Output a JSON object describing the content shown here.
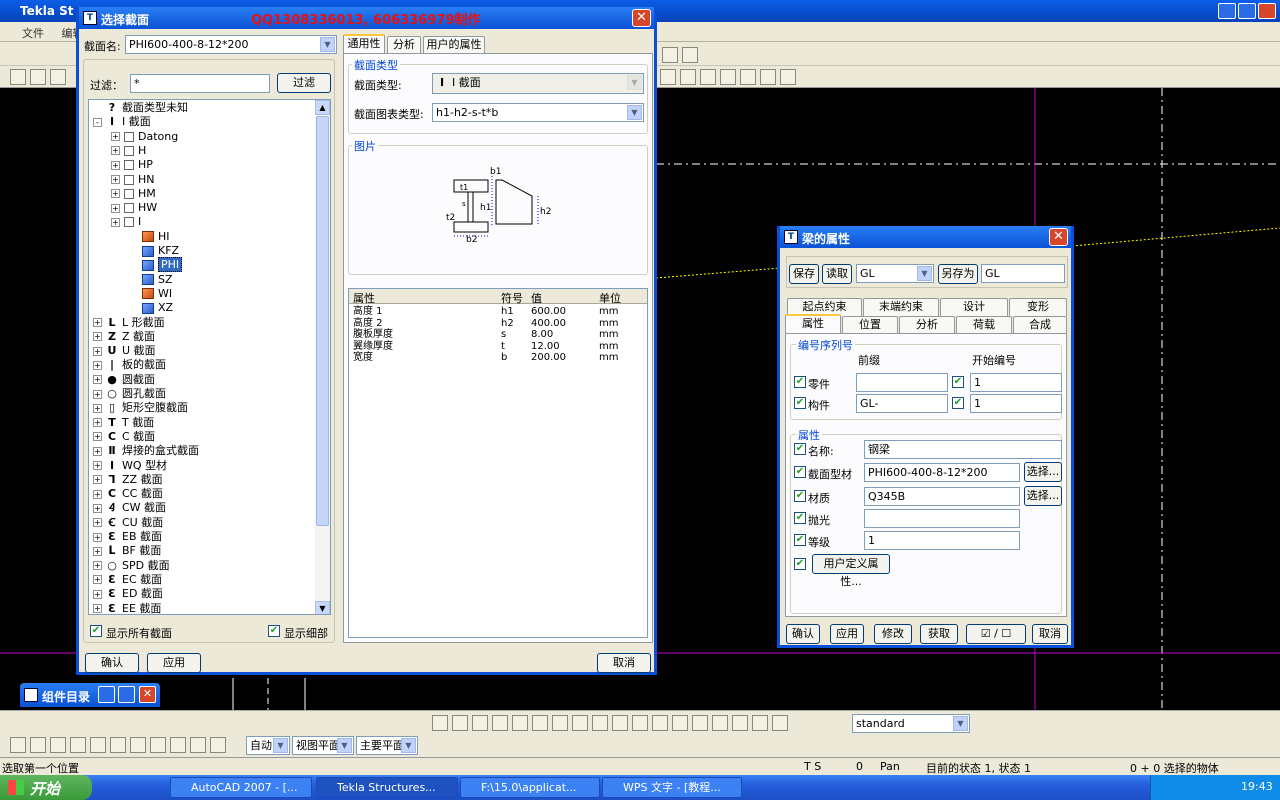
{
  "app": {
    "title": "Tekla St",
    "menu": [
      "文件",
      "编辑"
    ]
  },
  "section_dialog": {
    "title": "选择截面",
    "watermark": "QQ1308336013,  606336979制作",
    "section_name_label": "截面名:",
    "section_name_value": "PHI600-400-8-12*200",
    "filter_label": "过滤：",
    "filter_value": "*",
    "filter_button": "过滤",
    "tree": [
      {
        "label": "截面类型未知",
        "icon": "question-mark-icon",
        "level": 0,
        "exp": ""
      },
      {
        "label": "I 截面",
        "icon": "i-beam-icon",
        "level": 0,
        "exp": "-"
      },
      {
        "label": "Datong",
        "icon": "folder-icon",
        "level": 1,
        "exp": "+"
      },
      {
        "label": "H",
        "icon": "folder-icon",
        "level": 1,
        "exp": "+"
      },
      {
        "label": "HP",
        "icon": "folder-icon",
        "level": 1,
        "exp": "+"
      },
      {
        "label": "HN",
        "icon": "folder-icon",
        "level": 1,
        "exp": "+"
      },
      {
        "label": "HM",
        "icon": "folder-icon",
        "level": 1,
        "exp": "+"
      },
      {
        "label": "HW",
        "icon": "folder-icon",
        "level": 1,
        "exp": "+"
      },
      {
        "label": "I",
        "icon": "folder-icon",
        "level": 1,
        "exp": "+"
      },
      {
        "label": "HI",
        "icon": "cube-orange-icon",
        "level": 2,
        "exp": ""
      },
      {
        "label": "KFZ",
        "icon": "cube-blue-icon",
        "level": 2,
        "exp": ""
      },
      {
        "label": "PHI",
        "icon": "cube-blue-icon",
        "level": 2,
        "exp": "",
        "selected": true
      },
      {
        "label": "SZ",
        "icon": "cube-blue-icon",
        "level": 2,
        "exp": ""
      },
      {
        "label": "WI",
        "icon": "cube-orange-icon",
        "level": 2,
        "exp": ""
      },
      {
        "label": "XZ",
        "icon": "cube-blue-icon",
        "level": 2,
        "exp": ""
      },
      {
        "label": "L 形截面",
        "icon": "L",
        "level": 0,
        "exp": "+"
      },
      {
        "label": "Z 截面",
        "icon": "Z",
        "level": 0,
        "exp": "+"
      },
      {
        "label": "U 截面",
        "icon": "U",
        "level": 0,
        "exp": "+"
      },
      {
        "label": "板的截面",
        "icon": "|",
        "level": 0,
        "exp": "+"
      },
      {
        "label": "圆截面",
        "icon": "●",
        "level": 0,
        "exp": "+"
      },
      {
        "label": "圆孔截面",
        "icon": "○",
        "level": 0,
        "exp": "+"
      },
      {
        "label": "矩形空腹截面",
        "icon": "▯",
        "level": 0,
        "exp": "+"
      },
      {
        "label": "T 截面",
        "icon": "T",
        "level": 0,
        "exp": "+"
      },
      {
        "label": "C 截面",
        "icon": "C",
        "level": 0,
        "exp": "+"
      },
      {
        "label": "焊接的盒式截面",
        "icon": "Ⅱ",
        "level": 0,
        "exp": "+"
      },
      {
        "label": "WQ 型材",
        "icon": "Ⅰ",
        "level": 0,
        "exp": "+"
      },
      {
        "label": "ZZ 截面",
        "icon": "Ꞁ",
        "level": 0,
        "exp": "+"
      },
      {
        "label": "CC 截面",
        "icon": "C",
        "level": 0,
        "exp": "+"
      },
      {
        "label": "CW 截面",
        "icon": "Ꜭ",
        "level": 0,
        "exp": "+"
      },
      {
        "label": "CU 截面",
        "icon": "Ꞓ",
        "level": 0,
        "exp": "+"
      },
      {
        "label": "EB 截面",
        "icon": "Ɛ",
        "level": 0,
        "exp": "+"
      },
      {
        "label": "BF 截面",
        "icon": "ᒪ",
        "level": 0,
        "exp": "+"
      },
      {
        "label": "SPD 截面",
        "icon": "○",
        "level": 0,
        "exp": "+"
      },
      {
        "label": "EC 截面",
        "icon": "Ɛ",
        "level": 0,
        "exp": "+"
      },
      {
        "label": "ED 截面",
        "icon": "Ɛ",
        "level": 0,
        "exp": "+"
      },
      {
        "label": "EE 截面",
        "icon": "Ɛ",
        "level": 0,
        "exp": "+"
      }
    ],
    "show_all_label": "显示所有截面",
    "show_detail_label": "显示细部",
    "tabs": [
      "通用性",
      "分析",
      "用户的属性"
    ],
    "type_group_label": "截面类型",
    "type_label": "截面类型:",
    "type_value": "I 截面",
    "chart_type_label": "截面图表类型:",
    "chart_type_value": "h1-h2-s-t*b",
    "picture_label": "图片",
    "prop_headers": [
      "属性",
      "符号",
      "值",
      "单位"
    ],
    "props": [
      [
        "高度 1",
        "h1",
        "600.00",
        "mm"
      ],
      [
        "高度 2",
        "h2",
        "400.00",
        "mm"
      ],
      [
        "腹板厚度",
        "s",
        "8.00",
        "mm"
      ],
      [
        "翼缘厚度",
        "t",
        "12.00",
        "mm"
      ],
      [
        "宽度",
        "b",
        "200.00",
        "mm"
      ]
    ],
    "ok_button": "确认",
    "apply_button": "应用",
    "cancel_button": "取消"
  },
  "beam_dialog": {
    "title": "梁的属性",
    "save_button": "保存",
    "load_button": "读取",
    "preset_value": "GL",
    "save_as_button": "另存为",
    "save_as_value": "GL",
    "tabs_row1": [
      "起点约束",
      "末端约束",
      "设计",
      "变形"
    ],
    "tabs_row2": [
      "属性",
      "位置",
      "分析",
      "荷载",
      "合成"
    ],
    "numbering_label": "编号序列号",
    "prefix_label": "前缀",
    "start_no_label": "开始编号",
    "part_label": "零件",
    "part_prefix": "",
    "part_start": "1",
    "assembly_label": "构件",
    "assembly_prefix": "GL-",
    "assembly_start": "1",
    "attr_label": "属性",
    "name_label": "名称:",
    "name_value": "钢梁",
    "profile_label": "截面型材",
    "profile_value": "PHI600-400-8-12*200",
    "select_button": "选择...",
    "material_label": "材质",
    "material_value": "Q345B",
    "finish_label": "抛光",
    "finish_value": "",
    "class_label": "等级",
    "class_value": "1",
    "udf_button": "用户定义属性...",
    "ok_button": "确认",
    "apply_button": "应用",
    "modify_button": "修改",
    "get_button": "获取",
    "toggle_button": "☑ / ☐",
    "cancel_button": "取消"
  },
  "component_catalog": {
    "title": "组件目录"
  },
  "bottom_toolbar": {
    "view_select": "standard",
    "auto_select": "自动",
    "plane_select": "视图平面",
    "main_plane_select": "主要平面"
  },
  "status": {
    "prompt": "选取第一个位置",
    "ts": "T S",
    "zero": "0",
    "pan": "Pan",
    "state": "目前的状态 1, 状态 1",
    "selection": "0 + 0 选择的物体"
  },
  "taskbar": {
    "start": "开始",
    "items": [
      "AutoCAD 2007 - [...",
      "Tekla Structures...",
      "F:\\15.0\\applicat...",
      "WPS 文字 - [教程..."
    ],
    "clock": "19:43"
  }
}
